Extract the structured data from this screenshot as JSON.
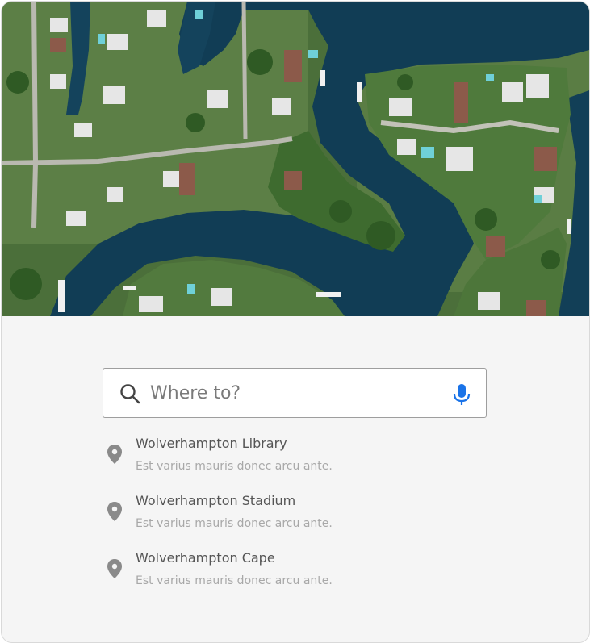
{
  "hero": {
    "image_alt": "Aerial view of waterfront homes and canals"
  },
  "search": {
    "placeholder": "Where to?",
    "value": "",
    "icon": "search-icon",
    "mic_icon": "microphone-icon",
    "mic_color": "#1a73e8"
  },
  "results": [
    {
      "title": "Wolverhampton Library",
      "subtitle": "Est varius mauris donec arcu ante."
    },
    {
      "title": "Wolverhampton Stadium",
      "subtitle": "Est varius mauris donec arcu ante."
    },
    {
      "title": "Wolverhampton Cape",
      "subtitle": "Est varius mauris donec arcu ante."
    }
  ],
  "colors": {
    "water": "#0f3a52",
    "land": "#4e7a3a",
    "panel": "#f5f5f5",
    "pin": "#8a8a8a"
  }
}
